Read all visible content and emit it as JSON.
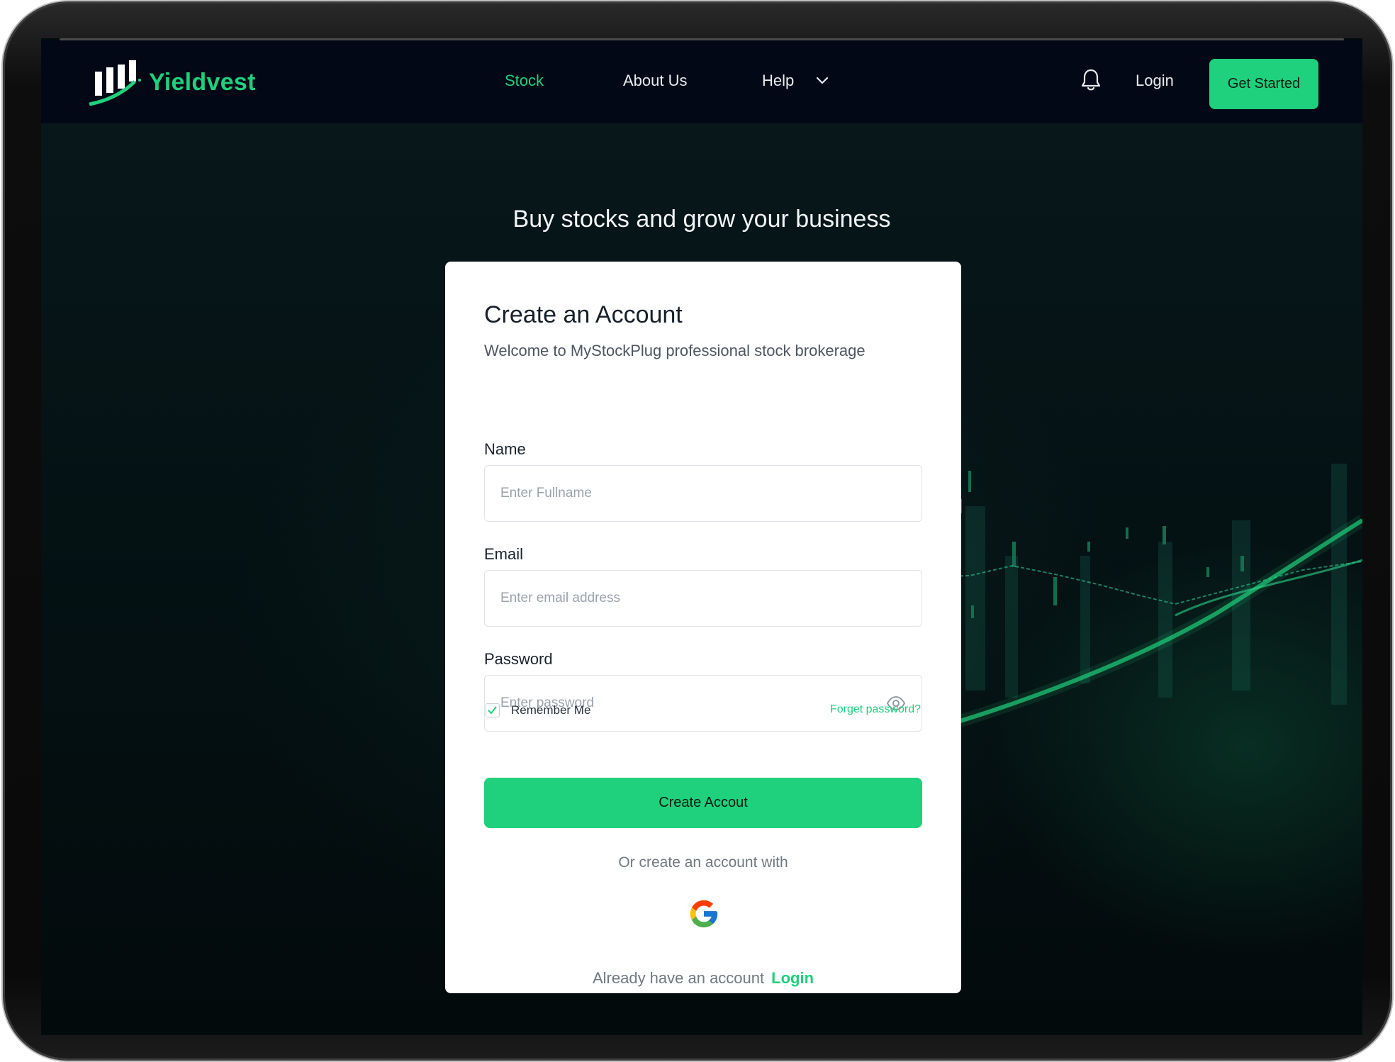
{
  "brand": {
    "name": "Yieldvest",
    "accent": "#1fd07c"
  },
  "nav": {
    "items": [
      {
        "label": "Stock",
        "active": true
      },
      {
        "label": "About Us",
        "active": false
      },
      {
        "label": "Help",
        "active": false
      }
    ],
    "icons": {
      "help_dropdown": "chevron-down-icon",
      "notifications": "bell-icon"
    },
    "login_label": "Login",
    "cta_label": "Get Started"
  },
  "hero": {
    "title": "Buy stocks and grow your business"
  },
  "form": {
    "title": "Create an Account",
    "subtitle": "Welcome to MyStockPlug professional stock brokerage",
    "name": {
      "label": "Name",
      "placeholder": "Enter Fullname",
      "value": ""
    },
    "email": {
      "label": "Email",
      "placeholder": "Enter email address",
      "value": ""
    },
    "password": {
      "label": "Password",
      "placeholder": "Enter password",
      "value": "",
      "toggle_icon": "eye-icon"
    },
    "remember_label": "Remember Me",
    "remember_checked": true,
    "forgot_label": "Forget password?",
    "submit_label": "Create Accout",
    "alt_text": "Or create an account with",
    "social_icon": "google-icon",
    "signin_prompt": "Already have an account",
    "signin_link": "Login"
  },
  "colors": {
    "accent": "#1fd07c",
    "navbar_bg": "#030816",
    "page_bg": "#041012",
    "card_bg": "#ffffff"
  }
}
